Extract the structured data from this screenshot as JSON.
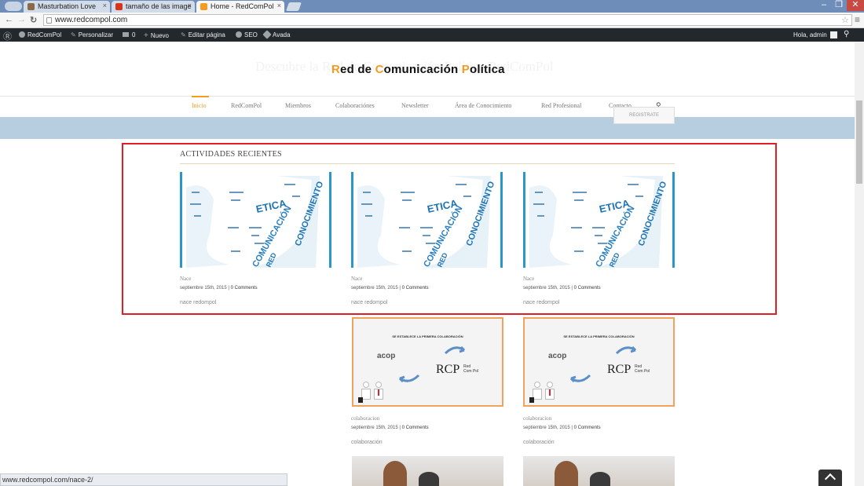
{
  "browser": {
    "tabs": [
      {
        "label": "Masturbation Love",
        "color": "#8a6a4a"
      },
      {
        "label": "tamaño de las image",
        "color": "#d9341a"
      },
      {
        "label": "Home - RedComPol",
        "color": "#f39c1f"
      }
    ],
    "close_glyph": "×",
    "url": "www.redcompol.com",
    "status_url": "www.redcompol.com/nace-2/"
  },
  "adminbar": {
    "site": "RedComPol",
    "customize": "Personalizar",
    "comments": "0",
    "new": "Nuevo",
    "edit": "Editar página",
    "seo": "SEO",
    "avada": "Avada",
    "greeting": "Hola, admin"
  },
  "site": {
    "logo": {
      "r": "R",
      "ed": "ed de ",
      "c": "C",
      "omunicacion": "omunicación ",
      "p": "P",
      "olitica": "olítica"
    },
    "ghost_text": "Descubre la Red de Comunicación Política RedComPol",
    "nav": [
      "Inicio",
      "RedComPol",
      "Miembros",
      "Colaboraciónes",
      "Newsletter",
      "Área de Conocimiento",
      "Red Profesional",
      "Contacto"
    ],
    "registrate": "REGISTRATE",
    "section_title": "ACTIVIDADES RECIENTES",
    "posts": [
      {
        "title": "Nace",
        "date": "septiembre 15th, 2015",
        "comments": "0 Comments",
        "category": "nace redompol"
      },
      {
        "title": "Nace",
        "date": "septiembre 15th, 2015",
        "comments": "0 Comments",
        "category": "nace redompol"
      },
      {
        "title": "Nace",
        "date": "septiembre 15th, 2015",
        "comments": "0 Comments",
        "category": "nace redompol"
      }
    ],
    "collab_posts": [
      {
        "title": "colaboracion",
        "date": "septiembre 15th, 2015",
        "comments": "0 Comments",
        "category": "colaboración",
        "banner": "SE ESTABLECE LA PRIMERA COLABORACIÓN",
        "acop": "acop",
        "red": "Red Com Pol"
      },
      {
        "title": "colaboracion",
        "date": "septiembre 15th, 2015",
        "comments": "0 Comments",
        "category": "colaboración",
        "banner": "SE ESTABLECE LA PRIMERA COLABORACIÓN",
        "acop": "acop",
        "red": "Red Com Pol"
      }
    ],
    "wordcloud": {
      "w1": "ETICA",
      "w2": "CONOCIMIENTO",
      "w3": "COMUNICACIÓN",
      "w4": "RED"
    }
  },
  "colors": {
    "accent": "#f39c1f",
    "highlight_box": "#e31d24",
    "image_border": "#2b97c9"
  }
}
